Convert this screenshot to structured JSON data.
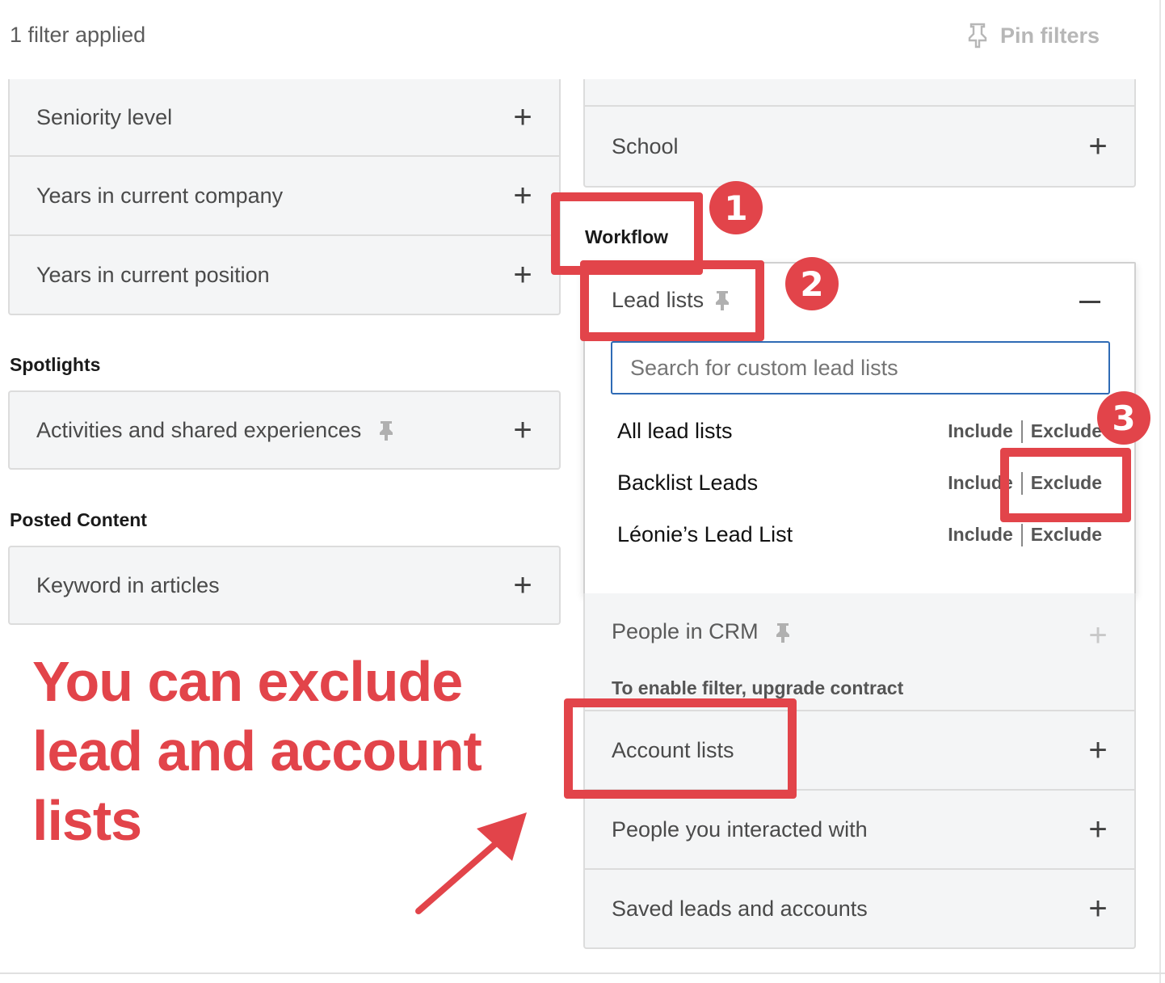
{
  "header": {
    "filter_status": "1 filter applied",
    "pin_filters_label": "Pin filters"
  },
  "left_panel_rows": [
    {
      "label": "Seniority level"
    },
    {
      "label": "Years in current company"
    },
    {
      "label": "Years in current position"
    }
  ],
  "spotlights": {
    "title": "Spotlights",
    "row_label": "Activities and shared experiences"
  },
  "posted_content": {
    "title": "Posted Content",
    "row_label": "Keyword in articles"
  },
  "right_top": {
    "school_label": "School"
  },
  "workflow": {
    "title": "Workflow",
    "lead_lists_label": "Lead lists",
    "search_placeholder": "Search for custom lead lists",
    "include_label": "Include",
    "exclude_label": "Exclude",
    "lists": [
      {
        "name": "All lead lists"
      },
      {
        "name": "Backlist Leads"
      },
      {
        "name": "Léonie’s Lead List"
      }
    ],
    "people_in_crm_label": "People in CRM",
    "upgrade_note": "To enable filter, upgrade contract",
    "account_lists_label": "Account lists",
    "people_interacted_label": "People you interacted with",
    "saved_leads_label": "Saved leads and accounts"
  },
  "annotations": {
    "badge_1": "1",
    "badge_2": "2",
    "badge_3": "3",
    "callout_line_1": "You can exclude",
    "callout_line_2": "lead and account",
    "callout_line_3": "lists",
    "accent_color": "#e2444a"
  }
}
